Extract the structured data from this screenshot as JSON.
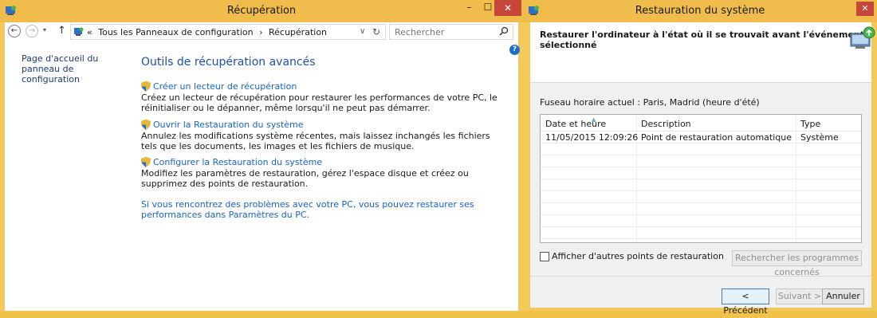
{
  "left_window": {
    "title": "Récupération",
    "controls": {
      "minimize": "–",
      "maximize": "☐",
      "close": "✕"
    },
    "nav": {
      "back": "←",
      "forward": "→",
      "dropdown": "▾",
      "up": "↑"
    },
    "address": {
      "prefix": "«",
      "crumbs": [
        "Tous les Panneaux de configuration",
        "›",
        "Récupération"
      ],
      "dropdown": "∨",
      "refresh": "↻"
    },
    "search": {
      "placeholder": "Rechercher",
      "icon": "search-icon"
    },
    "help": "?",
    "sidebar_link": "Page d'accueil du panneau de configuration",
    "main_title": "Outils de récupération avancés",
    "items": [
      {
        "link": "Créer un lecteur de récupération",
        "desc": "Créez un lecteur de récupération pour restaurer les performances de votre PC, le réinitialiser ou le dépanner, même lorsqu'il ne peut pas démarrer."
      },
      {
        "link": "Ouvrir la Restauration du système",
        "desc": "Annulez les modifications système récentes, mais laissez inchangés les fichiers tels que les documents, les images et les fichiers de musique."
      },
      {
        "link": "Configurer la Restauration du système",
        "desc": "Modifiez les paramètres de restauration, gérez l'espace disque et créez ou supprimez des points de restauration."
      }
    ],
    "bottom_link": "Si vous rencontrez des problèmes avec votre PC, vous pouvez restaurer ses performances dans Paramètres du PC."
  },
  "right_window": {
    "title": "Restauration du système",
    "close": "✕",
    "heading": "Restaurer l'ordinateur à l'état où il se trouvait avant l'événement sélectionné",
    "timezone": "Fuseau horaire actuel : Paris, Madrid (heure d'été)",
    "table": {
      "sort_indicator": "▲",
      "columns": [
        "Date et heure",
        "Description",
        "Type"
      ],
      "rows": [
        [
          "11/05/2015 12:09:26",
          "Point de restauration automatique",
          "Système"
        ]
      ]
    },
    "show_more_label": "Afficher d'autres points de restauration",
    "scan_button": "Rechercher les programmes concernés",
    "buttons": {
      "prev": "< Précédent",
      "next": "Suivant >",
      "cancel": "Annuler"
    }
  },
  "colors": {
    "titlebar": "#f0bc4b",
    "close_button": "#c7463a",
    "link_blue": "#1763c9",
    "heading_blue": "#1e50a8"
  }
}
